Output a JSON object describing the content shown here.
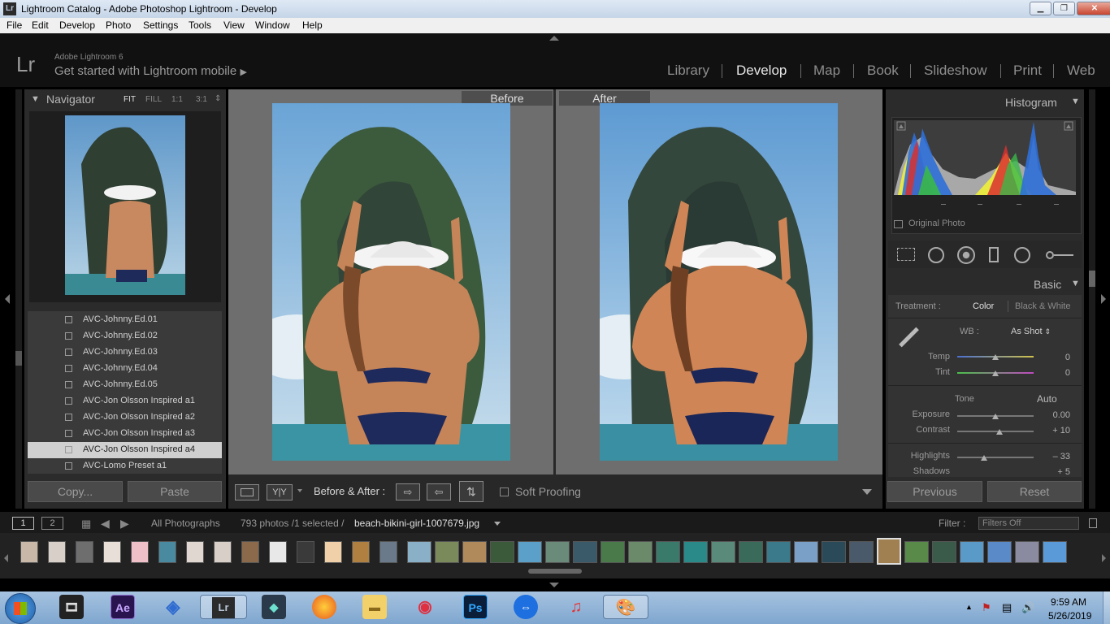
{
  "window": {
    "app_badge": "Lr",
    "title": "Lightroom Catalog - Adobe Photoshop Lightroom - Develop"
  },
  "menu": [
    "File",
    "Edit",
    "Develop",
    "Photo",
    "Settings",
    "Tools",
    "View",
    "Window",
    "Help"
  ],
  "identity": {
    "logo": "Lr",
    "version": "Adobe Lightroom 6",
    "mobile": "Get started with Lightroom mobile"
  },
  "modules": [
    "Library",
    "Develop",
    "Map",
    "Book",
    "Slideshow",
    "Print",
    "Web"
  ],
  "active_module": "Develop",
  "navigator": {
    "title": "Navigator",
    "zoom": [
      "FIT",
      "FILL",
      "1:1",
      "3:1"
    ]
  },
  "presets": [
    "AVC-Johnny.Ed.01",
    "AVC-Johnny.Ed.02",
    "AVC-Johnny.Ed.03",
    "AVC-Johnny.Ed.04",
    "AVC-Johnny.Ed.05",
    "AVC-Jon Olsson Inspired a1",
    "AVC-Jon Olsson Inspired a2",
    "AVC-Jon Olsson Inspired a3",
    "AVC-Jon Olsson Inspired a4",
    "AVC-Lomo Preset a1"
  ],
  "selected_preset_index": 8,
  "left_buttons": {
    "copy": "Copy...",
    "paste": "Paste"
  },
  "view": {
    "before": "Before",
    "after": "After"
  },
  "toolbar": {
    "yy": "Y|Y",
    "before_after": "Before & After :",
    "soft_proofing": "Soft Proofing"
  },
  "histogram": {
    "title": "Histogram",
    "original_photo": "Original Photo"
  },
  "basic": {
    "title": "Basic",
    "treatment_label": "Treatment :",
    "treatment_color": "Color",
    "treatment_bw": "Black & White",
    "wb_label": "WB :",
    "wb_value": "As Shot",
    "temp_label": "Temp",
    "temp_value": "0",
    "tint_label": "Tint",
    "tint_value": "0",
    "tone_label": "Tone",
    "auto": "Auto",
    "exposure_label": "Exposure",
    "exposure_value": "0.00",
    "contrast_label": "Contrast",
    "contrast_value": "+ 10",
    "highlights_label": "Highlights",
    "highlights_value": "– 33",
    "shadows_label": "Shadows",
    "shadows_value": "+ 5"
  },
  "right_buttons": {
    "previous": "Previous",
    "reset": "Reset"
  },
  "filmstrip": {
    "page1": "1",
    "page2": "2",
    "source": "All Photographs",
    "count": "793 photos /1 selected /",
    "filename": "beach-bikini-girl-1007679.jpg",
    "filter_label": "Filter :",
    "filter_value": "Filters Off"
  },
  "clock": {
    "time": "9:59 AM",
    "date": "5/26/2019"
  }
}
